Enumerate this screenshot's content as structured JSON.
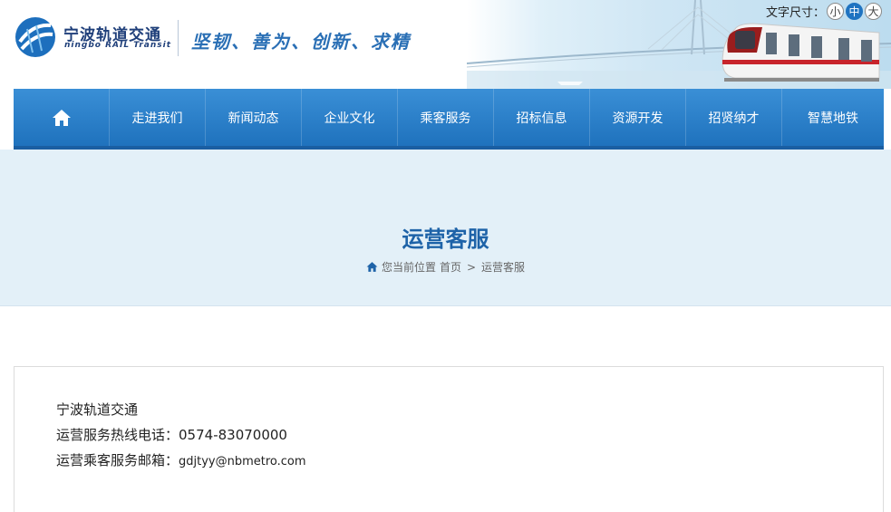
{
  "header": {
    "logo_cn": "宁波轨道交通",
    "logo_en": "ningbo RAIL Transit",
    "slogan": "坚韧、善为、创新、求精",
    "font_size_label": "文字尺寸：",
    "font_sizes": [
      "小",
      "中",
      "大"
    ],
    "font_size_selected": "中"
  },
  "nav": {
    "home_icon": "home-icon",
    "items": [
      "走进我们",
      "新闻动态",
      "企业文化",
      "乘客服务",
      "招标信息",
      "资源开发",
      "招贤纳才",
      "智慧地铁"
    ]
  },
  "banner": {
    "title": "运营客服",
    "breadcrumb_prefix": "您当前位置",
    "breadcrumb_home": "首页",
    "breadcrumb_sep": ">",
    "breadcrumb_current": "运营客服"
  },
  "content": {
    "company": "宁波轨道交通",
    "hotline_label": "运营服务热线电话：",
    "hotline_value": "0574-83070000",
    "email_label": "运营乘客服务邮箱：",
    "email_value": "gdjtyy@nbmetro.com"
  },
  "colors": {
    "nav_blue": "#2a80cb",
    "title_blue": "#1e63a8",
    "banner_bg": "#e3f0f8"
  }
}
